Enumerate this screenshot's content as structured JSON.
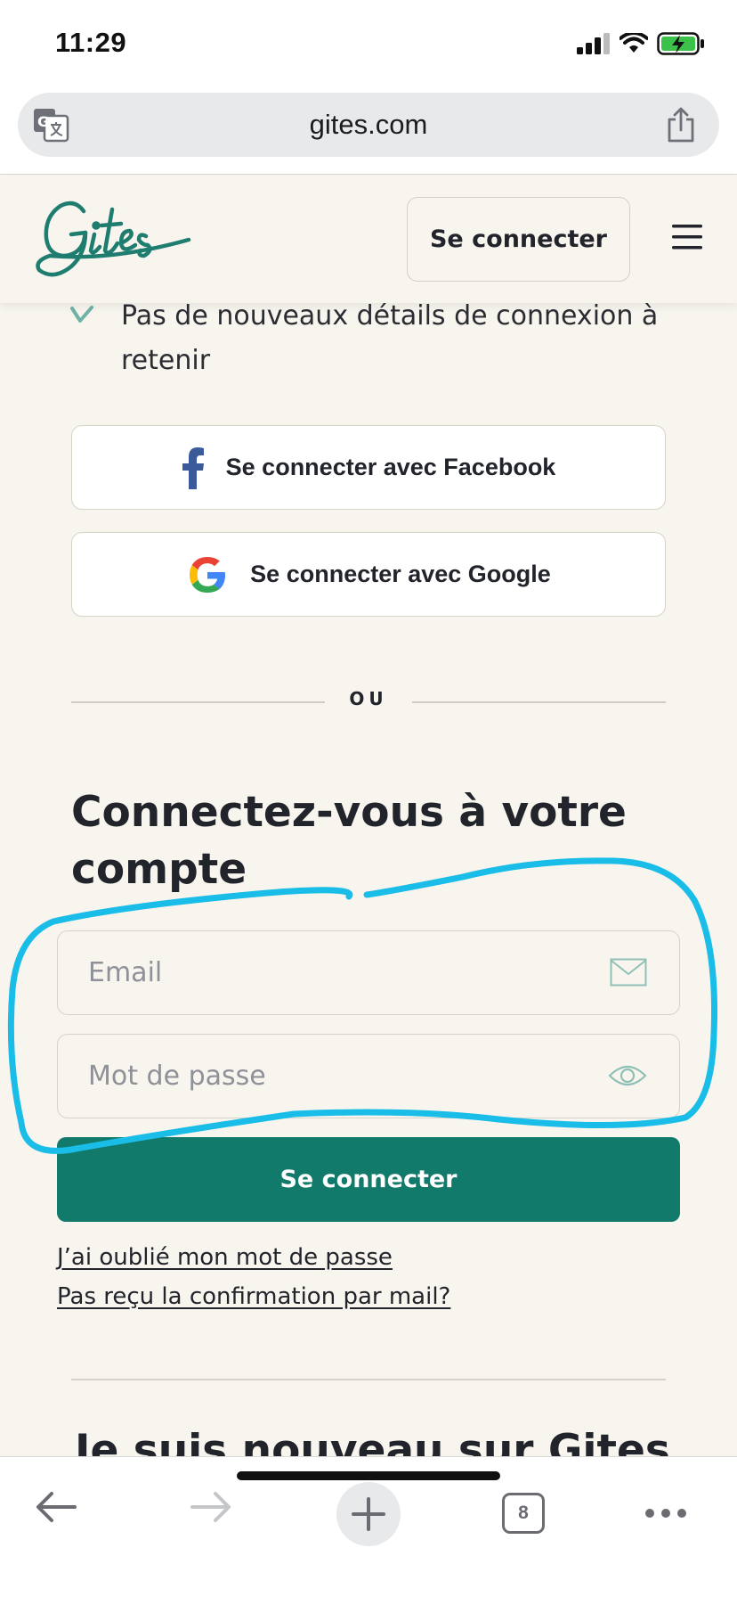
{
  "status_bar": {
    "time": "11:29"
  },
  "browser": {
    "url": "gites.com",
    "tab_count": "8"
  },
  "header": {
    "logo_text": "Gites",
    "login_button": "Se connecter"
  },
  "content": {
    "bullet_text": "Pas de nouveaux détails de connexion à retenir",
    "facebook_button": "Se connecter avec Facebook",
    "google_button": "Se connecter avec Google",
    "divider_text": "OU",
    "login_title": "Connectez-vous à votre compte",
    "email_placeholder": "Email",
    "password_placeholder": "Mot de passe",
    "submit_button": "Se connecter",
    "forgot_password_link": "J’ai oublié mon mot de passe",
    "confirmation_link": "Pas reçu la confirmation par mail?",
    "new_user_title": "Je suis nouveau sur Gites"
  },
  "colors": {
    "brand": "#127a6b",
    "background": "#f8f5ef",
    "annotation": "#19bde8"
  },
  "icons": {
    "status": [
      "cellular-signal-icon",
      "wifi-icon",
      "battery-charging-icon"
    ],
    "toolbar": [
      "back-arrow-icon",
      "forward-arrow-icon",
      "plus-icon",
      "tabs-icon",
      "more-icon"
    ]
  }
}
